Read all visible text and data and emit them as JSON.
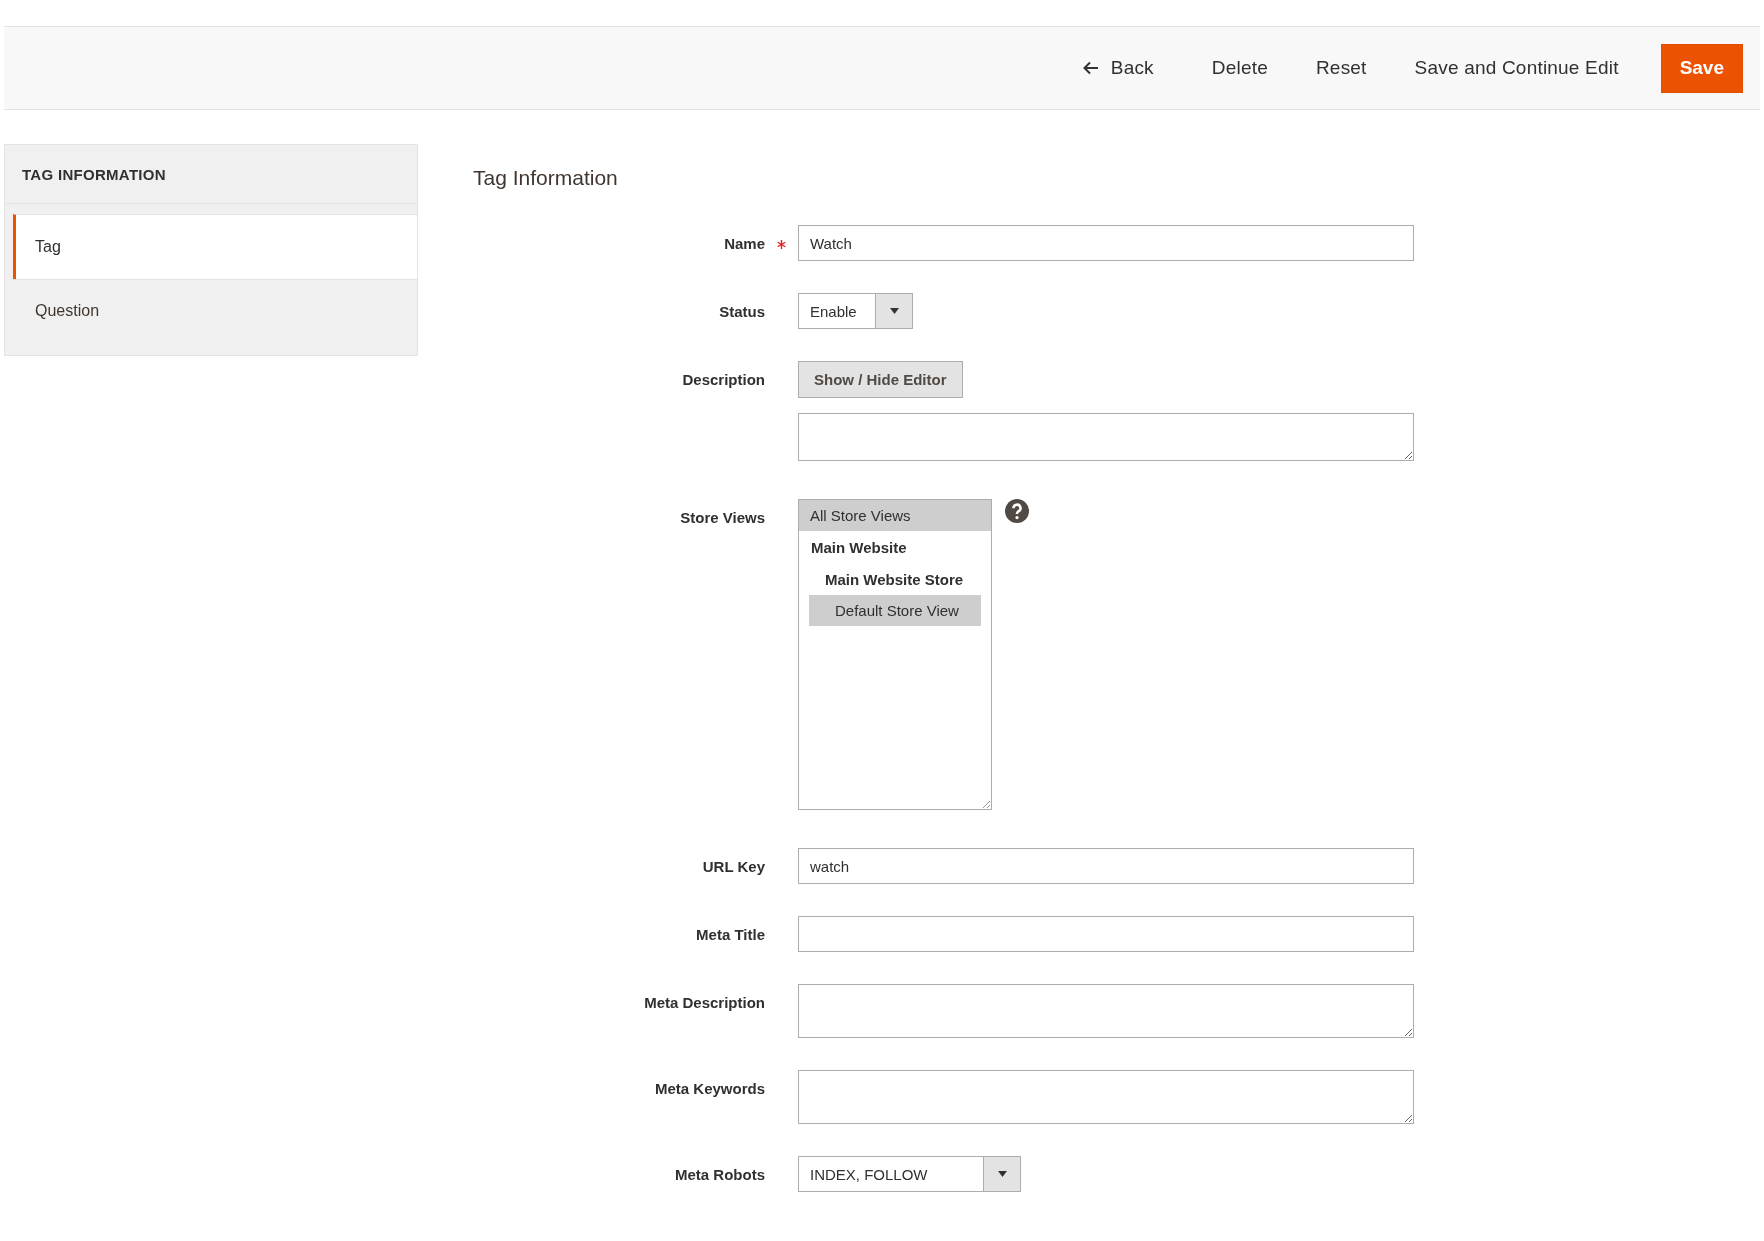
{
  "actions": [
    {
      "label": "Back",
      "kind": "back"
    },
    {
      "label": "Delete",
      "kind": "plain"
    },
    {
      "label": "Reset",
      "kind": "plain"
    },
    {
      "label": "Save and Continue Edit",
      "kind": "plain"
    },
    {
      "label": "Save",
      "kind": "primary"
    }
  ],
  "sidebar": {
    "title": "TAG INFORMATION",
    "items": [
      {
        "label": "Tag",
        "selected": true
      },
      {
        "label": "Question",
        "selected": false
      }
    ]
  },
  "form": {
    "title": "Tag Information",
    "fields": [
      {
        "label": "Name",
        "required": true,
        "kind": "text",
        "value": "Watch"
      },
      {
        "label": "Status",
        "required": false,
        "kind": "select",
        "value": "Enable",
        "wide": false
      },
      {
        "label": "Description",
        "required": false,
        "kind": "editor",
        "button": "Show / Hide Editor"
      },
      {
        "label": "Store Views",
        "required": false,
        "kind": "multiselect",
        "help": true,
        "options": [
          {
            "label": "All Store Views",
            "selected": true
          },
          {
            "label": "Main Website",
            "kind": "group",
            "selected": false,
            "children": [
              {
                "label": "Main Website Store",
                "kind": "group",
                "selected": false,
                "children": [
                  {
                    "label": "Default Store View",
                    "selected": true
                  }
                ]
              }
            ]
          }
        ]
      },
      {
        "label": "URL Key",
        "required": false,
        "kind": "text",
        "value": "watch"
      },
      {
        "label": "Meta Title",
        "required": false,
        "kind": "text"
      },
      {
        "label": "Meta Description",
        "required": false,
        "kind": "textarea"
      },
      {
        "label": "Meta Keywords",
        "required": false,
        "kind": "textarea"
      },
      {
        "label": "Meta Robots",
        "required": false,
        "kind": "select",
        "value": "INDEX, FOLLOW",
        "wide": true
      }
    ]
  }
}
